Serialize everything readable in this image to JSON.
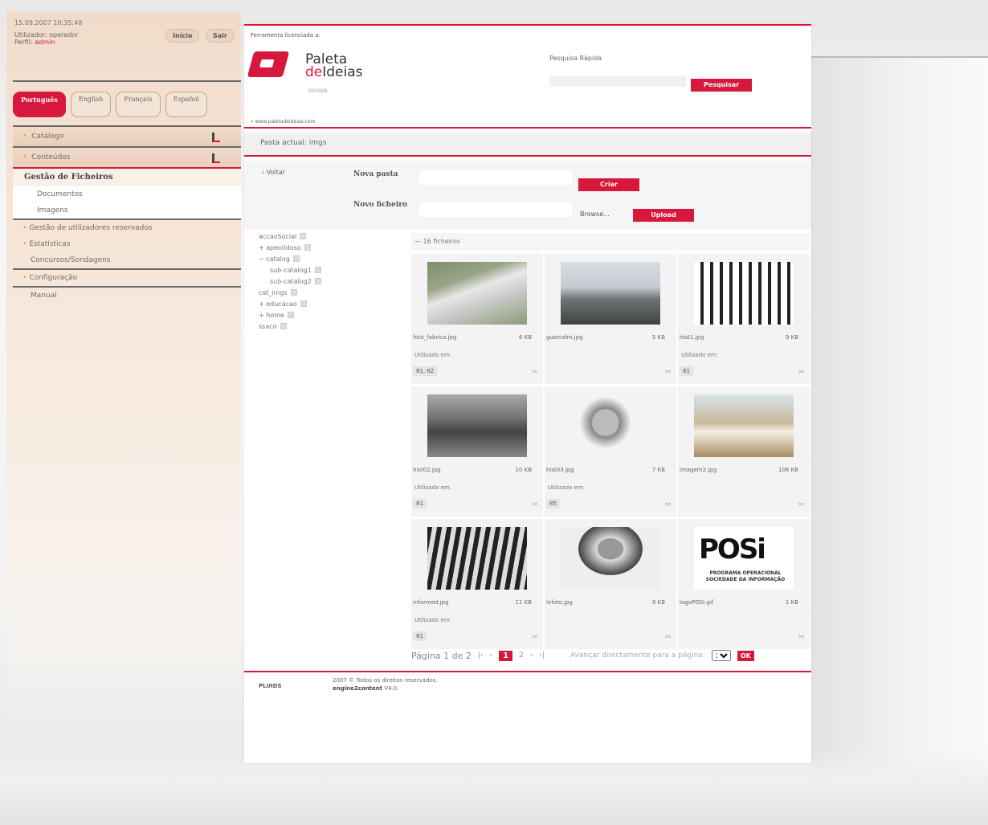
{
  "session": {
    "datetime": "15.09.2007 10:35:48",
    "user_line": "Utilizador: operador",
    "perfil_label": "Perfil:",
    "perfil_value": "admin",
    "inicio": "Início",
    "sair": "Sair"
  },
  "languages": [
    {
      "label": "Português",
      "active": true
    },
    {
      "label": "English",
      "active": false
    },
    {
      "label": "Français",
      "active": false
    },
    {
      "label": "Español",
      "active": false
    }
  ],
  "menu": {
    "catalogo": "Catálogo",
    "conteudos": "Conteúdos",
    "gestao_ficheiros": "Gestão de Ficheiros",
    "documentos": "Documentos",
    "imagens": "Imagens",
    "gestao_utilizadores": "Gestão de utilizadores reservados",
    "estatisticas": "Estatísticas",
    "concursos": "Concursos/Sondagens",
    "configuracao": "Configuração",
    "manual": "Manual"
  },
  "header": {
    "licensed": "Ferramenta licenciada a:",
    "logo_line1": "Paleta",
    "logo_line2a": "de",
    "logo_line2b": "Ideias",
    "logo_sub": "DESIGN",
    "site_url": "» www.paletadeideias.com",
    "search_label": "Pesquisa Rápida",
    "search_button": "Pesquisar"
  },
  "pasta_actual": "Pasta actual: imgs",
  "form": {
    "voltar": "‹ Voltar",
    "nova_pasta_label": "Nova pasta",
    "criar": "Criar",
    "novo_ficheiro_label": "Novo ficheiro",
    "browse": "Browse...",
    "upload": "Upload"
  },
  "tree": [
    {
      "label": "accaoSocial",
      "prefix": ""
    },
    {
      "label": "apeoildoso",
      "prefix": "+ "
    },
    {
      "label": "catalog",
      "prefix": "− "
    },
    {
      "label": "sub-catalog1",
      "prefix": "    "
    },
    {
      "label": "sub-catalog2",
      "prefix": "    "
    },
    {
      "label": "cat_imgs",
      "prefix": ""
    },
    {
      "label": "educacao",
      "prefix": "+ "
    },
    {
      "label": "home",
      "prefix": "+ "
    },
    {
      "label": "ssaco",
      "prefix": ""
    }
  ],
  "gallery": {
    "count_label": "— 16 ficheiros",
    "used_label": "Utilizado em:",
    "files": [
      {
        "name": "foto_fabrica.jpg",
        "size": "6 KB",
        "used": true,
        "tags": "81, 82",
        "art": "factory"
      },
      {
        "name": "guerrafro.jpg",
        "size": "5 KB",
        "used": false,
        "tags": "",
        "art": "rocks"
      },
      {
        "name": "hist1.jpg",
        "size": "9 KB",
        "used": true,
        "tags": "81",
        "art": "building"
      },
      {
        "name": "hist02.jpg",
        "size": "10 KB",
        "used": true,
        "tags": "81",
        "art": "crowd"
      },
      {
        "name": "hist03.jpg",
        "size": "7 KB",
        "used": true,
        "tags": "85",
        "art": "tool"
      },
      {
        "name": "imagem2.jpg",
        "size": "106 KB",
        "used": false,
        "tags": "",
        "art": "room"
      },
      {
        "name": "infarmed.jpg",
        "size": "11 KB",
        "used": true,
        "tags": "81",
        "art": "industry"
      },
      {
        "name": "lefoto.jpg",
        "size": "9 KB",
        "used": false,
        "tags": "",
        "art": "portrait"
      },
      {
        "name": "logoPOSI.gif",
        "size": "1 KB",
        "used": false,
        "tags": "",
        "art": "posi"
      }
    ],
    "posi_text": "POSi",
    "posi_sub1": "PROGRAMA OPERACIONAL",
    "posi_sub2": "SOCIEDADE DA INFORMAÇÃO"
  },
  "pager": {
    "label": "Página 1 de 2",
    "first": "|‹",
    "prev": "‹",
    "current": "1",
    "next_page": "2",
    "next": "›",
    "last": "›|",
    "goto_label": "Avançar directamente para a página:",
    "goto_value": "1",
    "ok": "OK"
  },
  "footer": {
    "logo": "PLUIDS",
    "copyright": "2007 © Todos os direitos reservados.",
    "version_bold": "engine2content",
    "version": " V4.0"
  },
  "colors": {
    "accent": "#d8173c",
    "sidebar": "#f1dccb",
    "dot": "#e7a02b"
  }
}
